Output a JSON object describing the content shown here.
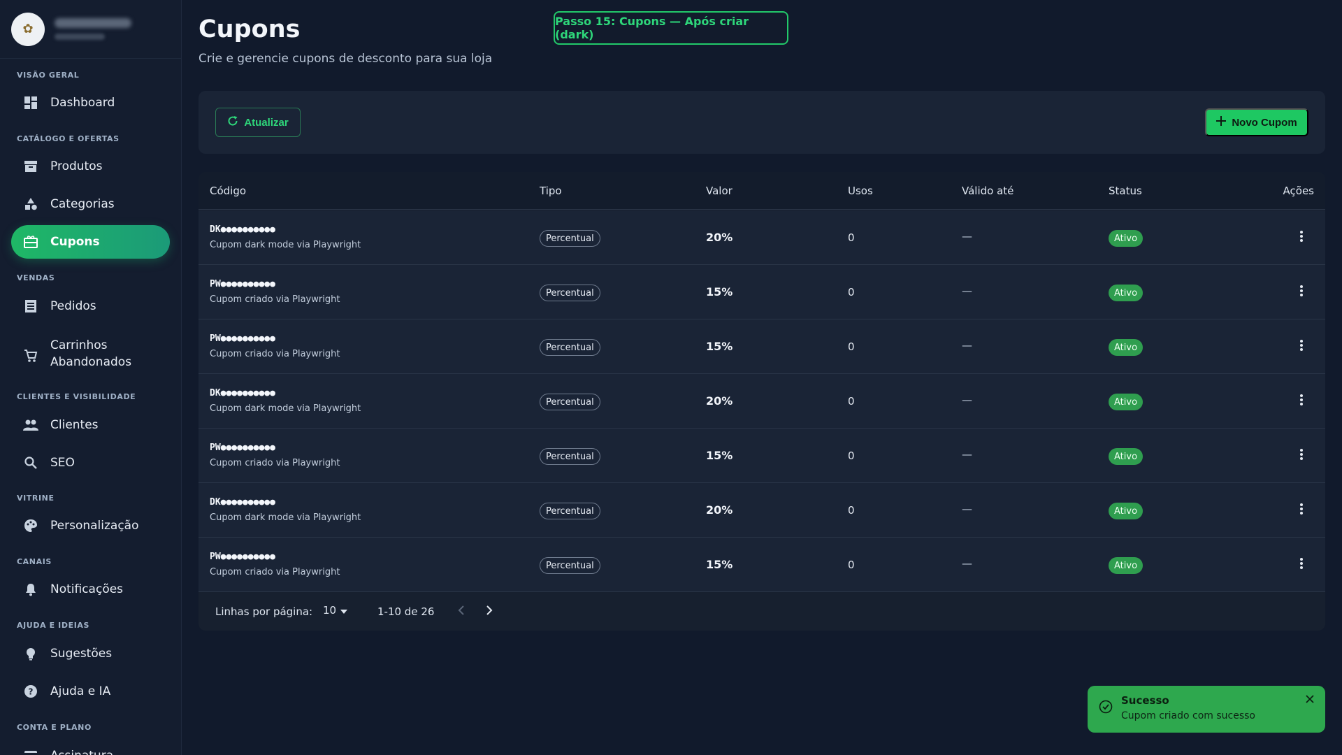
{
  "colors": {
    "accent": "#1ec862",
    "background": "#111a2c",
    "sidebar": "#141d2f",
    "status_active": "#2f9e4f",
    "toast": "#2ea84e"
  },
  "sidebar": {
    "sections": [
      {
        "title": "Visão geral"
      },
      {
        "title": "Catálogo e ofertas"
      },
      {
        "title": "Vendas"
      },
      {
        "title": "Clientes e visibilidade"
      },
      {
        "title": "Vitrine"
      },
      {
        "title": "Canais"
      },
      {
        "title": "Ajuda e ideias"
      },
      {
        "title": "Conta e plano"
      }
    ],
    "items": [
      {
        "label": "Dashboard",
        "icon": "dashboard-icon"
      },
      {
        "label": "Produtos",
        "icon": "archive-icon"
      },
      {
        "label": "Categorias",
        "icon": "category-icon"
      },
      {
        "label": "Cupons",
        "icon": "coupon-icon",
        "active": true
      },
      {
        "label": "Pedidos",
        "icon": "orders-icon"
      },
      {
        "label": "Carrinhos Abandonados",
        "icon": "cart-icon"
      },
      {
        "label": "Clientes",
        "icon": "people-icon"
      },
      {
        "label": "SEO",
        "icon": "search-icon"
      },
      {
        "label": "Personalização",
        "icon": "palette-icon"
      },
      {
        "label": "Notificações",
        "icon": "bell-icon"
      },
      {
        "label": "Sugestões",
        "icon": "lightbulb-icon"
      },
      {
        "label": "Ajuda e IA",
        "icon": "help-icon"
      },
      {
        "label": "Assinatura",
        "icon": "card-icon"
      }
    ]
  },
  "header": {
    "title": "Cupons",
    "subtitle": "Crie e gerencie cupons de desconto para sua loja",
    "step_banner": "Passo 15: Cupons — Após criar (dark)"
  },
  "toolbar": {
    "refresh_label": "Atualizar",
    "new_label": "Novo Cupom"
  },
  "table": {
    "columns": [
      "Código",
      "Tipo",
      "Valor",
      "Usos",
      "Válido até",
      "Status",
      "Ações"
    ],
    "rows": [
      {
        "code": "DK●●●●●●●●●●",
        "description": "Cupom dark mode via Playwright",
        "type": "Percentual",
        "value": "20%",
        "uses": "0",
        "valid_until": "—",
        "status": "Ativo"
      },
      {
        "code": "PW●●●●●●●●●●",
        "description": "Cupom criado via Playwright",
        "type": "Percentual",
        "value": "15%",
        "uses": "0",
        "valid_until": "—",
        "status": "Ativo"
      },
      {
        "code": "PW●●●●●●●●●●",
        "description": "Cupom criado via Playwright",
        "type": "Percentual",
        "value": "15%",
        "uses": "0",
        "valid_until": "—",
        "status": "Ativo"
      },
      {
        "code": "DK●●●●●●●●●●",
        "description": "Cupom dark mode via Playwright",
        "type": "Percentual",
        "value": "20%",
        "uses": "0",
        "valid_until": "—",
        "status": "Ativo"
      },
      {
        "code": "PW●●●●●●●●●●",
        "description": "Cupom criado via Playwright",
        "type": "Percentual",
        "value": "15%",
        "uses": "0",
        "valid_until": "—",
        "status": "Ativo"
      },
      {
        "code": "DK●●●●●●●●●●",
        "description": "Cupom dark mode via Playwright",
        "type": "Percentual",
        "value": "20%",
        "uses": "0",
        "valid_until": "—",
        "status": "Ativo"
      },
      {
        "code": "PW●●●●●●●●●●",
        "description": "Cupom criado via Playwright",
        "type": "Percentual",
        "value": "15%",
        "uses": "0",
        "valid_until": "—",
        "status": "Ativo"
      }
    ]
  },
  "pagination": {
    "rows_per_page_label": "Linhas por página:",
    "rows_per_page": "10",
    "range": "1-10 de 26"
  },
  "toast": {
    "title": "Sucesso",
    "message": "Cupom criado com sucesso"
  }
}
